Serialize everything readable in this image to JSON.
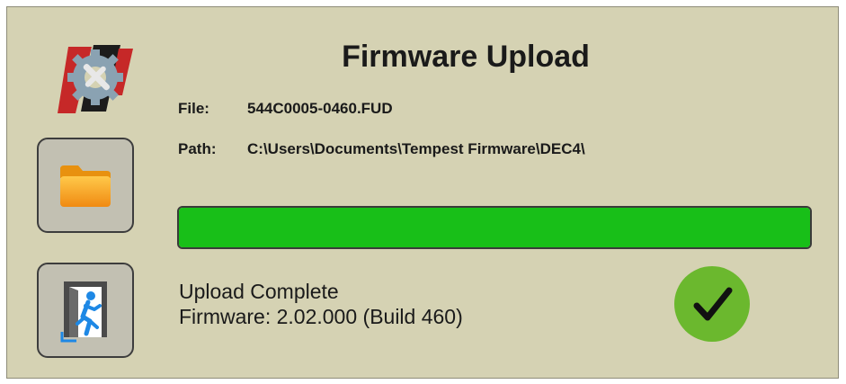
{
  "app": {
    "title": "Firmware Upload"
  },
  "file": {
    "label": "File:",
    "value": "544C0005-0460.FUD"
  },
  "path": {
    "label": "Path:",
    "value": "C:\\Users\\Documents\\Tempest Firmware\\DEC4\\"
  },
  "progress": {
    "percent": 100,
    "color": "#18bf18"
  },
  "status": {
    "title": "Upload Complete",
    "firmware_label": "Firmware: 2.02.000  (Build 460)"
  },
  "icons": {
    "logo": "wrench-gear-logo-icon",
    "folder_button": "folder-icon",
    "exit_button": "exit-door-icon",
    "status_badge": "checkmark-icon"
  },
  "colors": {
    "background": "#d5d2b3",
    "success": "#6bb82e"
  }
}
